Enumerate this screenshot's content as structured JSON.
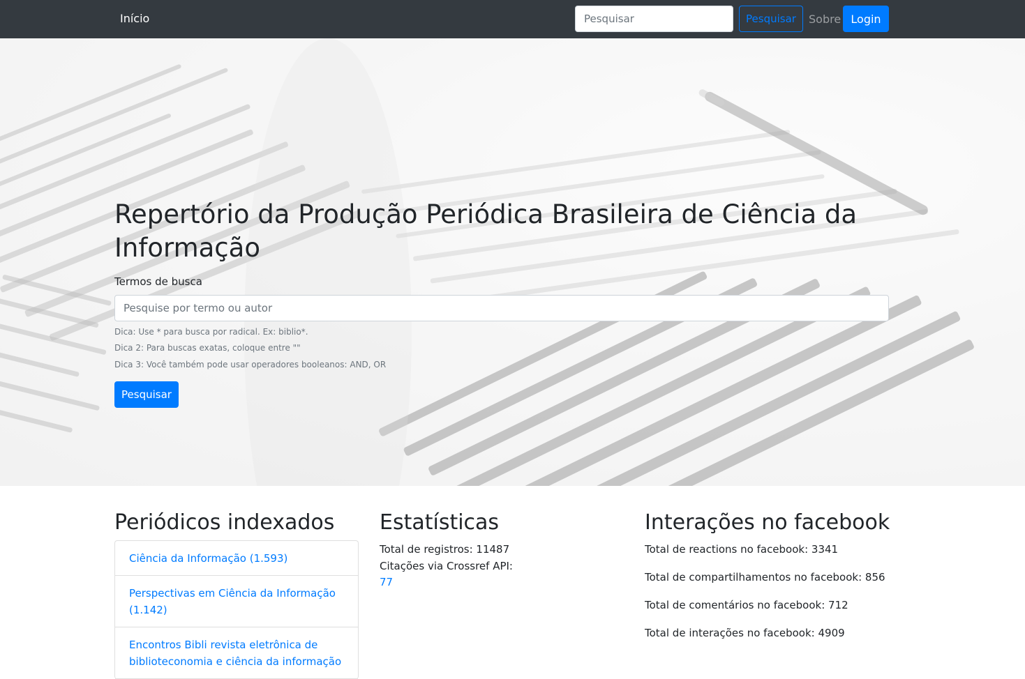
{
  "navbar": {
    "brand": "Início",
    "search_placeholder": "Pesquisar",
    "search_button": "Pesquisar",
    "about_link": "Sobre",
    "login_button": "Login"
  },
  "hero": {
    "title": "Repertório da Produção Periódica Brasileira de Ciência da Informação",
    "search_label": "Termos de busca",
    "search_placeholder": "Pesquise por termo ou autor",
    "hint1": "Dica: Use * para busca por radical. Ex: biblio*.",
    "hint2": "Dica 2: Para buscas exatas, coloque entre \"\"",
    "hint3": "Dica 3: Você também pode usar operadores booleanos: AND, OR",
    "search_button": "Pesquisar"
  },
  "periodicos": {
    "title": "Periódicos indexados",
    "items": [
      "Ciência da Informação (1.593)",
      "Perspectivas em Ciência da Informação (1.142)",
      "Encontros Bibli revista eletrônica de biblioteconomia e ciência da informação"
    ]
  },
  "estatisticas": {
    "title": "Estatísticas",
    "total_registros": "Total de registros: 11487",
    "citacoes_label": "Citações via Crossref API:",
    "citacoes_value": "77"
  },
  "facebook": {
    "title": "Interações no facebook",
    "reactions": "Total de reactions no facebook: 3341",
    "shares": "Total de compartilhamentos no facebook: 856",
    "comments": "Total de comentários no facebook: 712",
    "interactions": "Total de interações no facebook: 4909"
  }
}
